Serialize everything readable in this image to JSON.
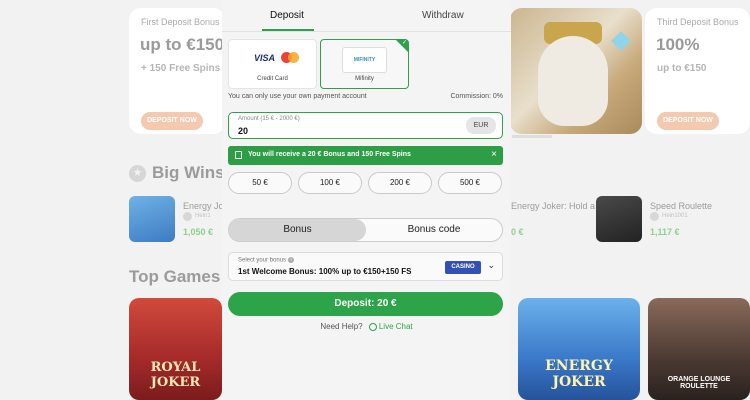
{
  "background": {
    "promos": [
      {
        "kicker": "First Deposit Bonus",
        "headline": "up to €150",
        "sub": "+ 150 Free Spins",
        "cta": "DEPOSIT NOW"
      },
      {
        "kicker": "Third Deposit Bonus",
        "headline": "100%",
        "sub": "up to €150",
        "cta": "DEPOSIT NOW"
      }
    ],
    "big_wins_title": "Big Wins",
    "wins": [
      {
        "game": "Energy Jo",
        "user": "Hein1",
        "amount": "1,050 €"
      },
      {
        "game": "Energy Joker: Hold a",
        "user": "",
        "amount": "0 €"
      },
      {
        "game": "Speed Roulette",
        "user": "Hein1001",
        "amount": "1,117 €"
      }
    ],
    "top_games_title": "Top Games",
    "tiles": [
      {
        "label": "ROYAL JOKER"
      },
      {
        "label": "ENERGY JOKER"
      },
      {
        "label": "ORANGE LOUNGE ROULETTE"
      }
    ]
  },
  "modal": {
    "tabs": {
      "deposit": "Deposit",
      "withdraw": "Withdraw"
    },
    "methods": [
      {
        "label": "Credit Card",
        "logo": "VISA"
      },
      {
        "label": "Mifinity",
        "logo": "MIFINITY"
      }
    ],
    "note_left": "You can only use your own payment account",
    "note_right": "Commission: 0%",
    "amount": {
      "placeholder": "Amount (15 € - 2000 €)",
      "value": "20",
      "currency": "EUR"
    },
    "bonus_banner": "You will receive a 20 € Bonus and 150 Free Spins",
    "quick_amounts": [
      "50 €",
      "100 €",
      "200 €",
      "500 €"
    ],
    "segment": {
      "bonus": "Bonus",
      "bonus_code": "Bonus code"
    },
    "select": {
      "caption": "Select your bonus",
      "value": "1st Welcome Bonus: 100% up to €150+150 FS",
      "tag": "CASINO"
    },
    "deposit_button": "Deposit: 20 €",
    "help": {
      "question": "Need Help?",
      "link": "Live Chat"
    }
  },
  "colors": {
    "accent": "#2da449",
    "casino_tag": "#3351b4"
  }
}
